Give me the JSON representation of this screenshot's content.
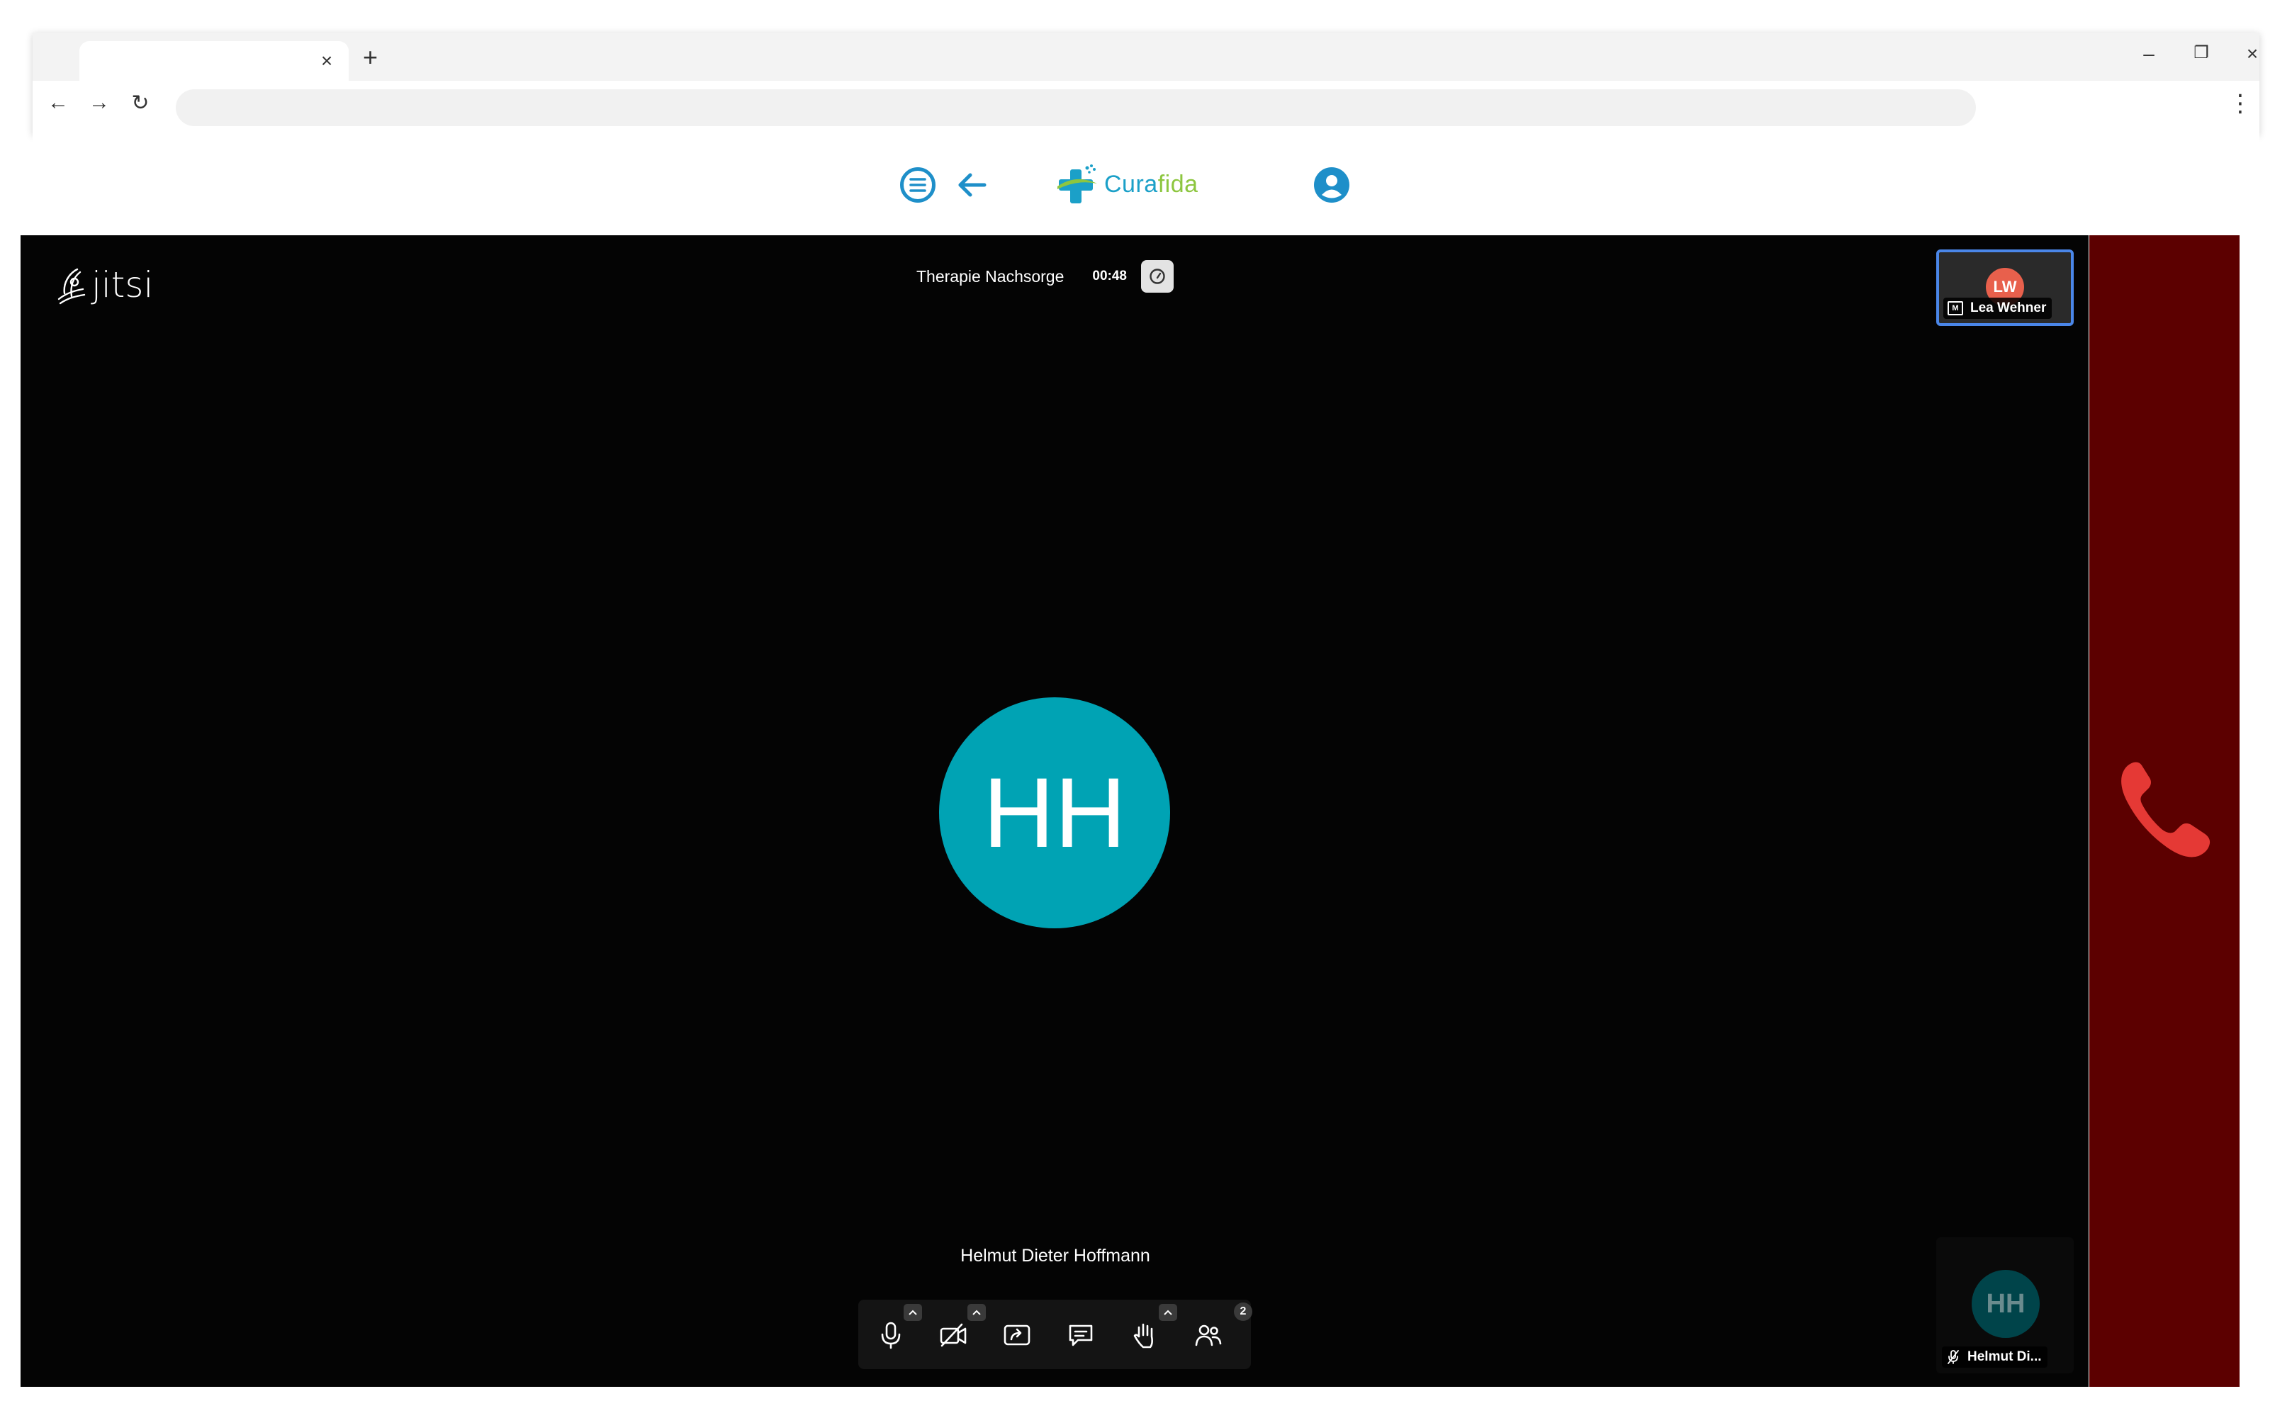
{
  "browser": {
    "tab": {
      "title": "",
      "close": "×"
    },
    "new_tab": "+",
    "window_controls": {
      "minimize": "–",
      "restore": "❐",
      "close": "×"
    },
    "nav": {
      "back": "←",
      "forward": "→",
      "reload": "↻"
    },
    "address": {
      "value": "",
      "placeholder": ""
    },
    "menu": "⋮"
  },
  "app_header": {
    "logo": {
      "part1": "Cura",
      "part2": "fida"
    },
    "accent_color": "#1e8fc9"
  },
  "meeting": {
    "brand": "jitsi",
    "subject": "Therapie Nachsorge",
    "timer": "00:48",
    "dominant_speaker": {
      "initials": "HH",
      "name": "Helmut Dieter Hoffmann",
      "color": "#00a3b4"
    },
    "toolbar": {
      "buttons": [
        "microphone-icon",
        "camera-off-icon",
        "screenshare-icon",
        "chat-icon",
        "raise-hand-icon",
        "participants-icon"
      ],
      "participant_count": "2"
    },
    "thumbnails": [
      {
        "initials": "LW",
        "name": "Lea Wehner",
        "badge": "M",
        "color": "#e8604c"
      },
      {
        "initials": "HH",
        "name": "Helmut Di...",
        "color": "#00444a"
      }
    ],
    "hangup_color": "#e53935",
    "filmstrip_color": "#5c0000"
  }
}
